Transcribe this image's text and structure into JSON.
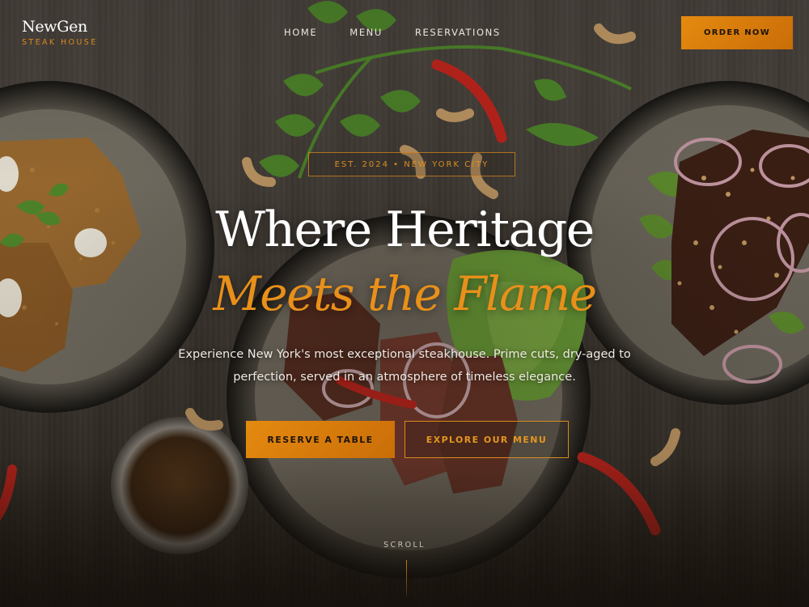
{
  "brand": {
    "name": "NewGen",
    "tagline": "STEAK HOUSE"
  },
  "nav": {
    "links": [
      "HOME",
      "MENU",
      "RESERVATIONS"
    ],
    "cta": "ORDER NOW"
  },
  "hero": {
    "badge": "EST. 2024 • NEW YORK CITY",
    "headline_line1": "Where Heritage",
    "headline_line2": "Meets the Flame",
    "subtitle": "Experience New York's most exceptional steakhouse. Prime cuts, dry-aged to perfection, served in an atmosphere of timeless elegance.",
    "primary_button": "RESERVE A TABLE",
    "secondary_button": "EXPLORE OUR MENU",
    "scroll_label": "SCROLL"
  },
  "colors": {
    "accent": "#e58a0f",
    "accent_text": "#e8901a",
    "background": "#3f3a35"
  }
}
